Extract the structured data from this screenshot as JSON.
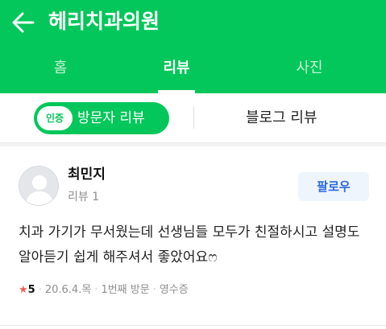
{
  "header": {
    "back_icon": "arrow-left-icon",
    "title": "헤리치과의원",
    "bg_color": "#03c75a"
  },
  "tabs": [
    {
      "label": "홈",
      "active": false
    },
    {
      "label": "리뷰",
      "active": true
    },
    {
      "label": "사진",
      "active": false
    }
  ],
  "review_filters": {
    "visitor": {
      "badge": "인증",
      "label": "방문자 리뷰",
      "active": true
    },
    "blog": {
      "label": "블로그 리뷰",
      "active": false
    }
  },
  "review": {
    "user": {
      "name": "최민지",
      "meta": "리뷰 1",
      "avatar_icon": "default-avatar-icon"
    },
    "follow_label": "팔로우",
    "text": "치과 가기가 무서웠는데 선생님들 모두가 친절하시고 설명도 알아듣기 쉽게 해주셔서 좋았어요ෆ",
    "rating": "5",
    "date": "20.6.4.목",
    "visit": "1번째 방문",
    "receipt": "영수증"
  }
}
